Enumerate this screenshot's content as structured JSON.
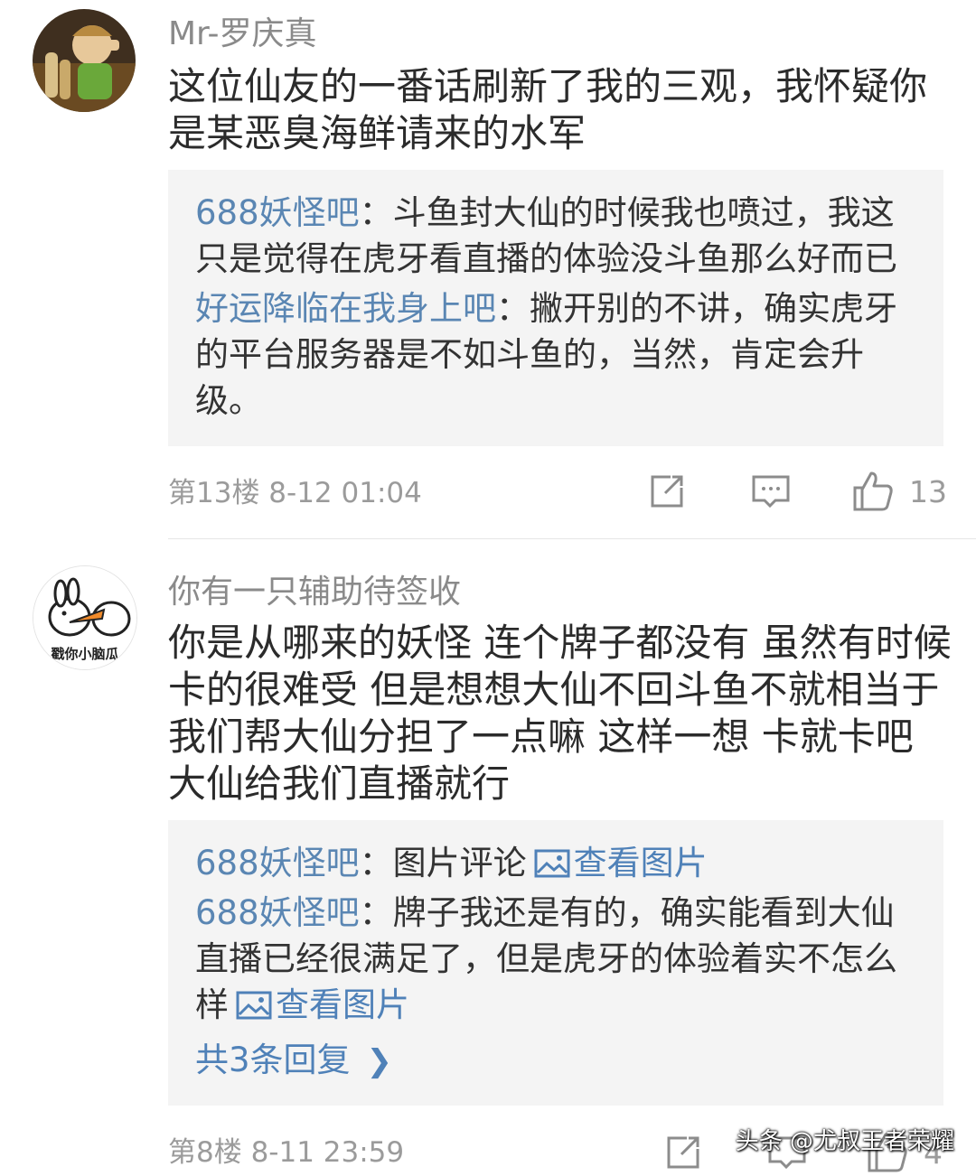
{
  "comments": [
    {
      "username": "Mr-罗庆真",
      "content": "这位仙友的一番话刷新了我的三观，我怀疑你是某恶臭海鲜请来的水军",
      "replies": [
        {
          "name": "688妖怪吧",
          "sep": "：",
          "text": "斗鱼封大仙的时候我也喷过，我这只是觉得在虎牙看直播的体验没斗鱼那么好而已"
        },
        {
          "name": "好运降临在我身上吧",
          "sep": "：",
          "text": "撇开别的不讲，确实虎牙的平台服务器是不如斗鱼的，当然，肯定会升级。"
        }
      ],
      "meta": "第13楼  8-12 01:04",
      "like_count": "13"
    },
    {
      "username": "你有一只辅助待签收",
      "avatar_text": "戳你小脑瓜",
      "content": "你是从哪来的妖怪 连个牌子都没有 虽然有时候卡的很难受 但是想想大仙不回斗鱼不就相当于我们帮大仙分担了一点嘛 这样一想 卡就卡吧 大仙给我们直播就行",
      "replies": [
        {
          "name": "688妖怪吧",
          "sep": "：",
          "text": "图片评论",
          "link": "查看图片"
        },
        {
          "name": "688妖怪吧",
          "sep": "：",
          "text": "牌子我还是有的，确实能看到大仙直播已经很满足了，但是虎牙的体验着实不怎么样",
          "link": "查看图片"
        }
      ],
      "more_replies": "共3条回复",
      "meta": "第8楼  8-11 23:59",
      "like_count": "4"
    }
  ],
  "watermark": "头条 @尤叔王者荣耀",
  "colors": {
    "link": "#4f81b8",
    "reply_name": "#5a86b3",
    "meta": "#9b9b9b",
    "reply_bg": "#f4f4f4"
  }
}
